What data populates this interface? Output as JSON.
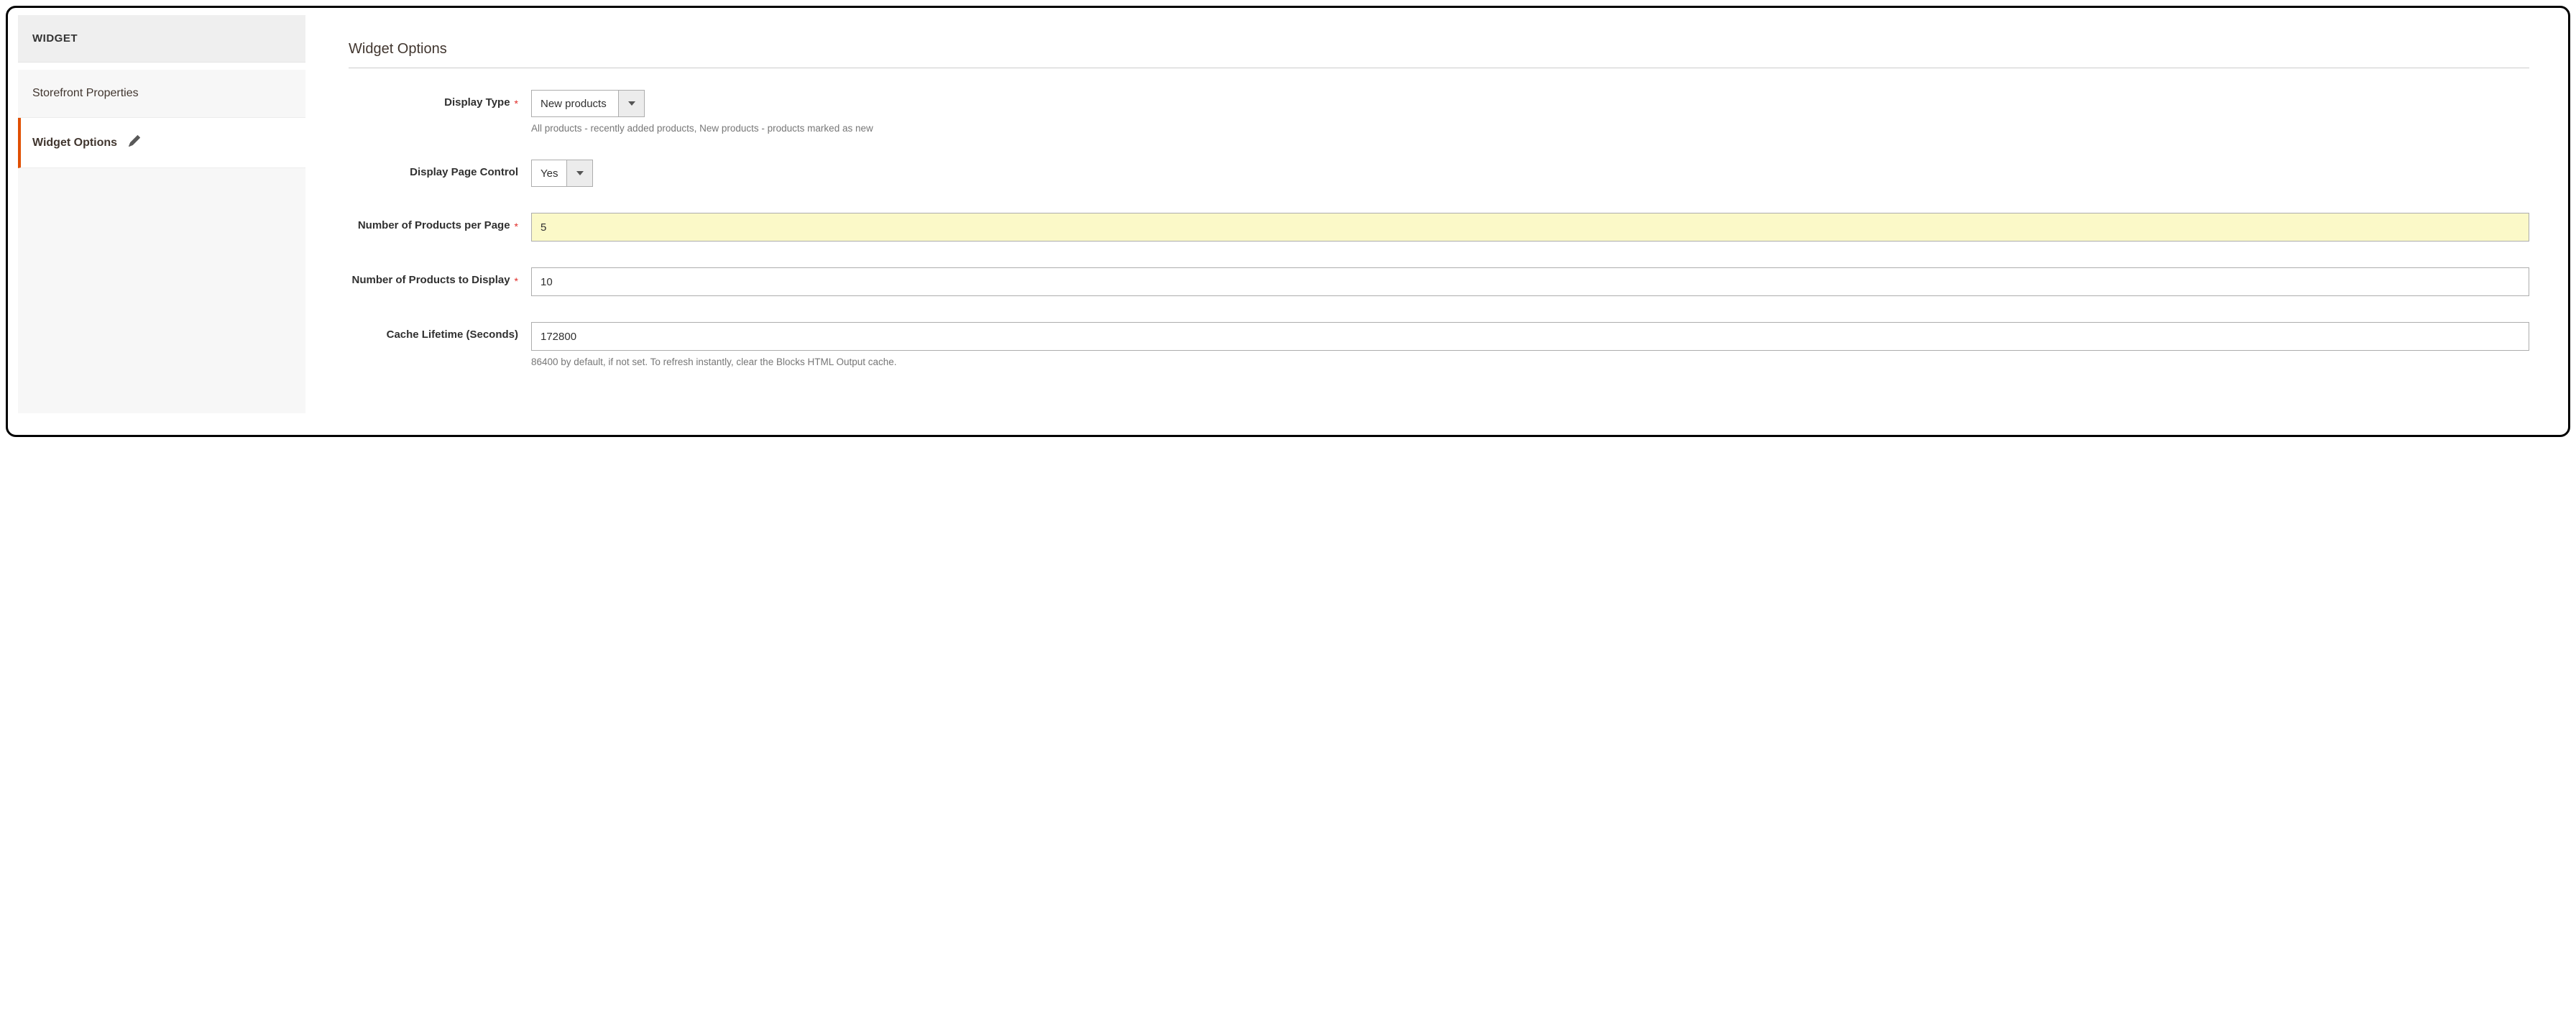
{
  "sidebar": {
    "header": "WIDGET",
    "items": [
      {
        "label": "Storefront Properties"
      },
      {
        "label": "Widget Options"
      }
    ]
  },
  "section": {
    "title": "Widget Options"
  },
  "fields": {
    "display_type": {
      "label": "Display Type",
      "value": "New products",
      "note": "All products - recently added products, New products - products marked as new"
    },
    "display_page_control": {
      "label": "Display Page Control",
      "value": "Yes"
    },
    "products_per_page": {
      "label": "Number of Products per Page",
      "value": "5"
    },
    "products_to_display": {
      "label": "Number of Products to Display",
      "value": "10"
    },
    "cache_lifetime": {
      "label": "Cache Lifetime (Seconds)",
      "value": "172800",
      "note": "86400 by default, if not set. To refresh instantly, clear the Blocks HTML Output cache."
    }
  },
  "required_marker": "*"
}
